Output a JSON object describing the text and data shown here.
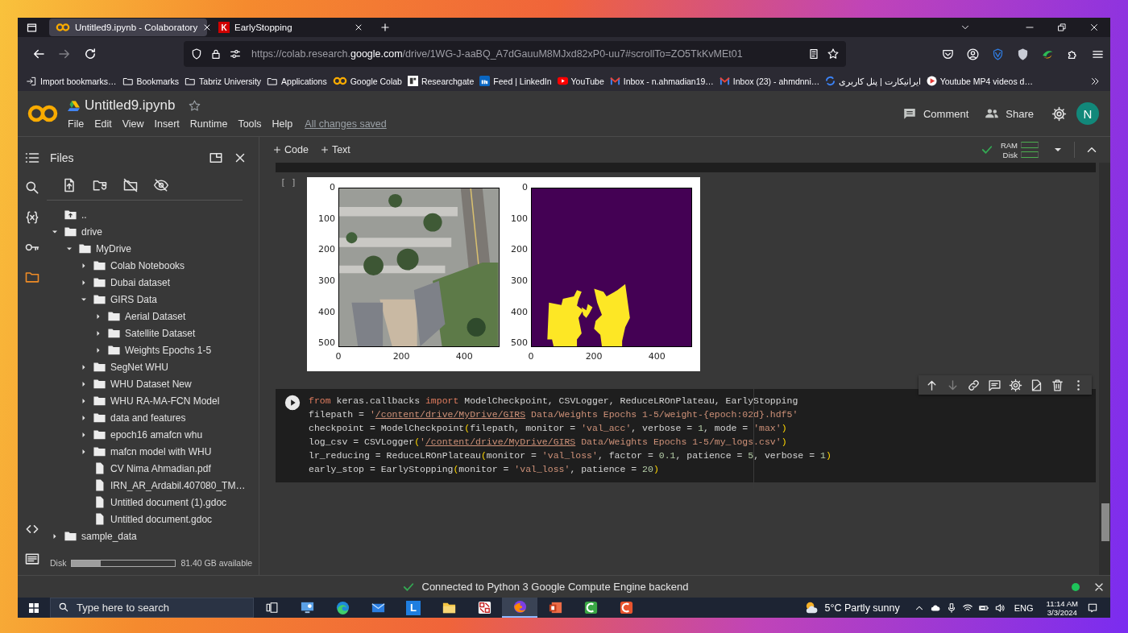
{
  "browser": {
    "tabs": [
      {
        "kind": "rings",
        "title": "Untitled9.ipynb - Colaboratory",
        "selected": true
      },
      {
        "kind": "letter",
        "glyph": "K",
        "title": "EarlyStopping",
        "selected": false
      }
    ],
    "url": {
      "host": "https://colab.research.",
      "domain": "google.com",
      "path": "/drive/1WG-J-aaBQ_A7dGauuM8MJxd82xP0-uu7#scrollTo=ZO5TkKvMEt01"
    },
    "bookmarks": [
      {
        "kind": "import",
        "label": "Import bookmarks…"
      },
      {
        "kind": "folder",
        "label": "Bookmarks"
      },
      {
        "kind": "folder",
        "label": "Tabriz University"
      },
      {
        "kind": "folder",
        "label": "Applications"
      },
      {
        "kind": "rings",
        "label": "Google Colab"
      },
      {
        "kind": "tile",
        "label": "Researchgate"
      },
      {
        "kind": "square",
        "label": "Feed | LinkedIn"
      },
      {
        "kind": "play",
        "label": "YouTube"
      },
      {
        "kind": "mail",
        "label": "Inbox - n.ahmadian19…"
      },
      {
        "kind": "mail",
        "label": "Inbox (23) - ahmdnni…"
      },
      {
        "kind": "swirl",
        "label": "ایرانیکارت | پنل کاربری"
      },
      {
        "kind": "round-play",
        "label": "Youtube MP4 videos d…"
      }
    ]
  },
  "notebook": {
    "title": "Untitled9.ipynb",
    "menu": [
      "File",
      "Edit",
      "View",
      "Insert",
      "Runtime",
      "Tools",
      "Help"
    ],
    "save_status": "All changes saved",
    "actions": [
      {
        "kind": "comment",
        "label": "Comment"
      },
      {
        "kind": "share",
        "label": "Share"
      }
    ],
    "avatar": "N",
    "insert_buttons": [
      "Code",
      "Text"
    ],
    "resources": [
      "RAM",
      "Disk"
    ]
  },
  "sidebar": {
    "rail": [
      {
        "kind": "contents",
        "selected": false
      },
      {
        "kind": "search",
        "selected": false
      },
      {
        "kind": "variables",
        "selected": false
      },
      {
        "kind": "secrets",
        "selected": false
      },
      {
        "kind": "files",
        "selected": true
      },
      {
        "kind": "snippets",
        "selected": false
      },
      {
        "kind": "terminal",
        "selected": false
      }
    ],
    "title": "Files",
    "tree": [
      {
        "kind": "parent",
        "name": ".."
      },
      {
        "kind": "folder",
        "name": "drive",
        "expanded": true,
        "children": [
          {
            "kind": "folder",
            "name": "MyDrive",
            "expanded": true,
            "children": [
              {
                "kind": "folder",
                "name": "Colab Notebooks",
                "expanded": false
              },
              {
                "kind": "folder",
                "name": "Dubai dataset",
                "expanded": false
              },
              {
                "kind": "folder",
                "name": "GIRS Data",
                "expanded": true,
                "children": [
                  {
                    "kind": "folder",
                    "name": "Aerial Dataset",
                    "expanded": false
                  },
                  {
                    "kind": "folder",
                    "name": "Satellite Dataset",
                    "expanded": false
                  },
                  {
                    "kind": "folder",
                    "name": "Weights Epochs 1-5",
                    "expanded": false
                  }
                ]
              },
              {
                "kind": "folder",
                "name": "SegNet WHU",
                "expanded": false
              },
              {
                "kind": "folder",
                "name": "WHU Dataset New",
                "expanded": false
              },
              {
                "kind": "folder",
                "name": "WHU RA-MA-FCN Model",
                "expanded": false
              },
              {
                "kind": "folder",
                "name": "data and features",
                "expanded": false
              },
              {
                "kind": "folder",
                "name": "epoch16 amafcn whu",
                "expanded": false
              },
              {
                "kind": "folder",
                "name": "mafcn model with WHU",
                "expanded": false
              },
              {
                "kind": "file",
                "name": "CV Nima Ahmadian.pdf"
              },
              {
                "kind": "file",
                "name": "IRN_AR_Ardabil.407080_TM…"
              },
              {
                "kind": "file",
                "name": "Untitled document (1).gdoc"
              },
              {
                "kind": "file",
                "name": "Untitled document.gdoc"
              }
            ]
          }
        ]
      },
      {
        "kind": "folder",
        "name": "sample_data",
        "expanded": false
      }
    ],
    "disk": {
      "label": "Disk",
      "level": 0.28,
      "free": "81.40 GB available"
    }
  },
  "output": {
    "prompt": "[ ]",
    "panels": [
      {
        "yticks": [
          "0",
          "100",
          "200",
          "300",
          "400",
          "500"
        ],
        "xticks": [
          "0",
          "200",
          "400"
        ]
      },
      {
        "kind": "mask",
        "yticks": [
          "0",
          "100",
          "200",
          "300",
          "400",
          "500"
        ],
        "xticks": [
          "0",
          "200",
          "400"
        ]
      }
    ]
  },
  "code_cell": {
    "lines": [
      [
        {
          "kind": "keyword",
          "text": "from"
        },
        {
          "kind": "plain",
          "text": " keras.callbacks "
        },
        {
          "kind": "keyword",
          "text": "import"
        },
        {
          "kind": "plain",
          "text": " ModelCheckpoint, CSVLogger, ReduceLROnPlateau, EarlyStopping"
        }
      ],
      [
        {
          "kind": "plain",
          "text": "filepath = "
        },
        {
          "kind": "string",
          "text": "'"
        },
        {
          "kind": "path",
          "text": "/content/drive/MyDrive/GIRS"
        },
        {
          "kind": "string",
          "text": " Data/Weights Epochs 1-5/weight-{epoch:02d}.hdf5'"
        }
      ],
      [
        {
          "kind": "plain",
          "text": "checkpoint = ModelCheckpoint"
        },
        {
          "kind": "bracket",
          "text": "("
        },
        {
          "kind": "plain",
          "text": "filepath, monitor = "
        },
        {
          "kind": "string",
          "text": "'val_acc'"
        },
        {
          "kind": "plain",
          "text": ", verbose = "
        },
        {
          "kind": "number",
          "text": "1"
        },
        {
          "kind": "plain",
          "text": ", mode = "
        },
        {
          "kind": "string",
          "text": "'max'"
        },
        {
          "kind": "bracket",
          "text": ")"
        }
      ],
      [
        {
          "kind": "plain",
          "text": "log_csv = CSVLogger"
        },
        {
          "kind": "bracket",
          "text": "("
        },
        {
          "kind": "string",
          "text": "'"
        },
        {
          "kind": "path",
          "text": "/content/drive/MyDrive/GIRS"
        },
        {
          "kind": "string",
          "text": " Data/Weights Epochs 1-5/my_logs.csv'"
        },
        {
          "kind": "bracket",
          "text": ")"
        }
      ],
      [
        {
          "kind": "plain",
          "text": "lr_reducing = ReduceLROnPlateau"
        },
        {
          "kind": "bracket",
          "text": "("
        },
        {
          "kind": "plain",
          "text": "monitor = "
        },
        {
          "kind": "string",
          "text": "'val_loss'"
        },
        {
          "kind": "plain",
          "text": ", factor = "
        },
        {
          "kind": "number",
          "text": "0.1"
        },
        {
          "kind": "plain",
          "text": ", patience = "
        },
        {
          "kind": "number",
          "text": "5"
        },
        {
          "kind": "plain",
          "text": ", verbose = "
        },
        {
          "kind": "number",
          "text": "1"
        },
        {
          "kind": "bracket",
          "text": ")"
        }
      ],
      [
        {
          "kind": "plain",
          "text": "early_stop = EarlyStopping"
        },
        {
          "kind": "bracket",
          "text": "("
        },
        {
          "kind": "plain",
          "text": "monitor = "
        },
        {
          "kind": "string",
          "text": "'val_loss'"
        },
        {
          "kind": "plain",
          "text": ", patience = "
        },
        {
          "kind": "number",
          "text": "20"
        },
        {
          "kind": "bracket",
          "text": ")"
        }
      ]
    ]
  },
  "status_bar": {
    "message": "Connected to Python 3 Google Compute Engine backend"
  },
  "taskbar": {
    "placeholder": "Type here to search",
    "apps": [
      {
        "kind": "taskview",
        "selected": false
      },
      {
        "kind": "monitor",
        "selected": false
      },
      {
        "kind": "swirl",
        "selected": false
      },
      {
        "kind": "mail",
        "selected": false
      },
      {
        "kind": "letter",
        "glyph": "L",
        "selected": false
      },
      {
        "kind": "folder",
        "selected": false
      },
      {
        "kind": "red-tile",
        "selected": false
      },
      {
        "kind": "globe",
        "selected": true
      },
      {
        "kind": "slides",
        "selected": false
      },
      {
        "kind": "green-ring",
        "selected": false
      },
      {
        "kind": "orange-ring",
        "selected": false
      }
    ],
    "weather": "5°C Partly sunny",
    "language": "ENG",
    "time": "11:14 AM",
    "date": "3/3/2024"
  }
}
